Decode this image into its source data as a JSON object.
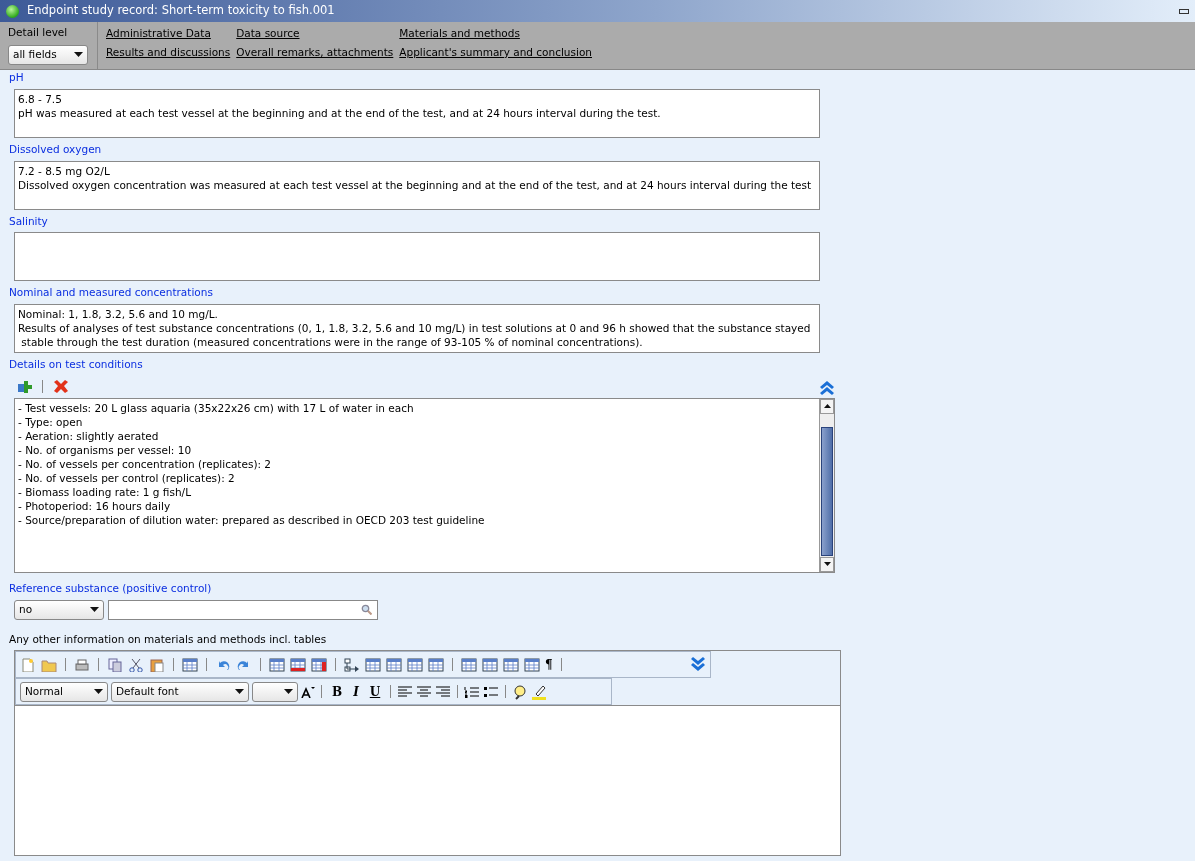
{
  "window": {
    "title": "Endpoint study record: Short-term toxicity to fish.001"
  },
  "detail_level": {
    "label": "Detail level",
    "value": "all fields"
  },
  "nav_links": [
    "Administrative Data",
    "Data source",
    "Materials and methods",
    "Results and discussions",
    "Overall remarks, attachments",
    "Applicant's summary and conclusion"
  ],
  "fields": [
    {
      "kind": "text",
      "label": "pH",
      "lines": [
        "6.8 - 7.5",
        "pH was measured at each test vessel at the beginning and at the end of the test, and at 24 hours interval during the test."
      ]
    },
    {
      "kind": "text",
      "label": "Dissolved oxygen",
      "lines": [
        "7.2 - 8.5 mg O2/L",
        "Dissolved oxygen concentration was measured at each test vessel at the beginning and at the end of the test, and at 24 hours interval during the test"
      ]
    },
    {
      "kind": "text",
      "label": "Salinity"
    },
    {
      "kind": "text",
      "label": "Nominal and measured concentrations",
      "lines": [
        "Nominal: 1, 1.8, 3.2, 5.6 and 10 mg/L.",
        "Results of analyses of test substance concentrations (0, 1, 1.8, 3.2, 5.6 and 10 mg/L) in test solutions at 0 and 96 h showed that the substance stayed",
        " stable through the test duration (measured concentrations were in the range of 93-105 % of nominal concentrations)."
      ]
    },
    {
      "kind": "list",
      "label": "Details on test conditions",
      "lines": [
        "- Test vessels: 20 L glass aquaria (35x22x26 cm) with 17 L of water in each",
        "- Type: open",
        "- Aeration: slightly aerated",
        "- No. of organisms per vessel: 10",
        "- No. of vessels per concentration (replicates): 2",
        "- No. of vessels per control (replicates): 2",
        "- Biomass loading rate: 1 g fish/L",
        "- Photoperiod: 16 hours daily",
        "- Source/preparation of dilution water: prepared as described in OECD 203 test guideline"
      ]
    },
    {
      "kind": "select",
      "label": "Reference substance (positive control)",
      "value": "no"
    },
    {
      "kind": "editor",
      "label": "Any other information on materials and methods incl. tables",
      "style": "Normal",
      "font": "Default font",
      "pilcrow": "¶",
      "bold": "B",
      "italic": "I",
      "underline": "U"
    }
  ]
}
